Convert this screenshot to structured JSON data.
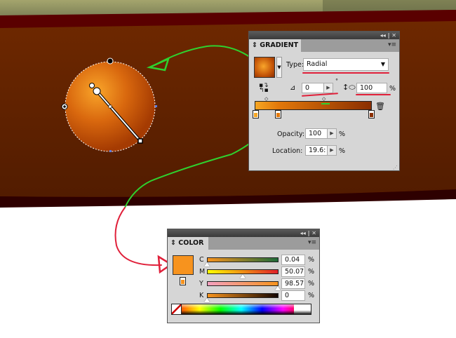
{
  "colors": {
    "accent_green": "#2fd12f",
    "accent_red": "#e0203a",
    "gradient_start": "#f6a623",
    "gradient_end": "#8a2e00"
  },
  "gradient_panel": {
    "title": "GRADIENT",
    "window_controls": "◂◂ | ✕",
    "menu_icon": "▾≡",
    "type_label": "Type:",
    "type_value": "Radial",
    "angle_value": "0",
    "degree_symbol": "°",
    "aspect_value": "100",
    "aspect_unit": "%",
    "opacity_label": "Opacity:",
    "opacity_value": "100",
    "opacity_unit": "%",
    "location_label": "Location:",
    "location_value": "19.6:",
    "location_unit": "%"
  },
  "color_panel": {
    "title": "COLOR",
    "window_controls": "◂◂ | ✕",
    "menu_icon": "▾≡",
    "channels": [
      {
        "label": "C",
        "value": "0.04",
        "unit": "%",
        "fraction": 0.0004
      },
      {
        "label": "M",
        "value": "50.07",
        "unit": "%",
        "fraction": 0.5007
      },
      {
        "label": "Y",
        "value": "98.57",
        "unit": "%",
        "fraction": 0.9857
      },
      {
        "label": "K",
        "value": "0",
        "unit": "%",
        "fraction": 0
      }
    ],
    "swatch_color": "#f7931e"
  }
}
